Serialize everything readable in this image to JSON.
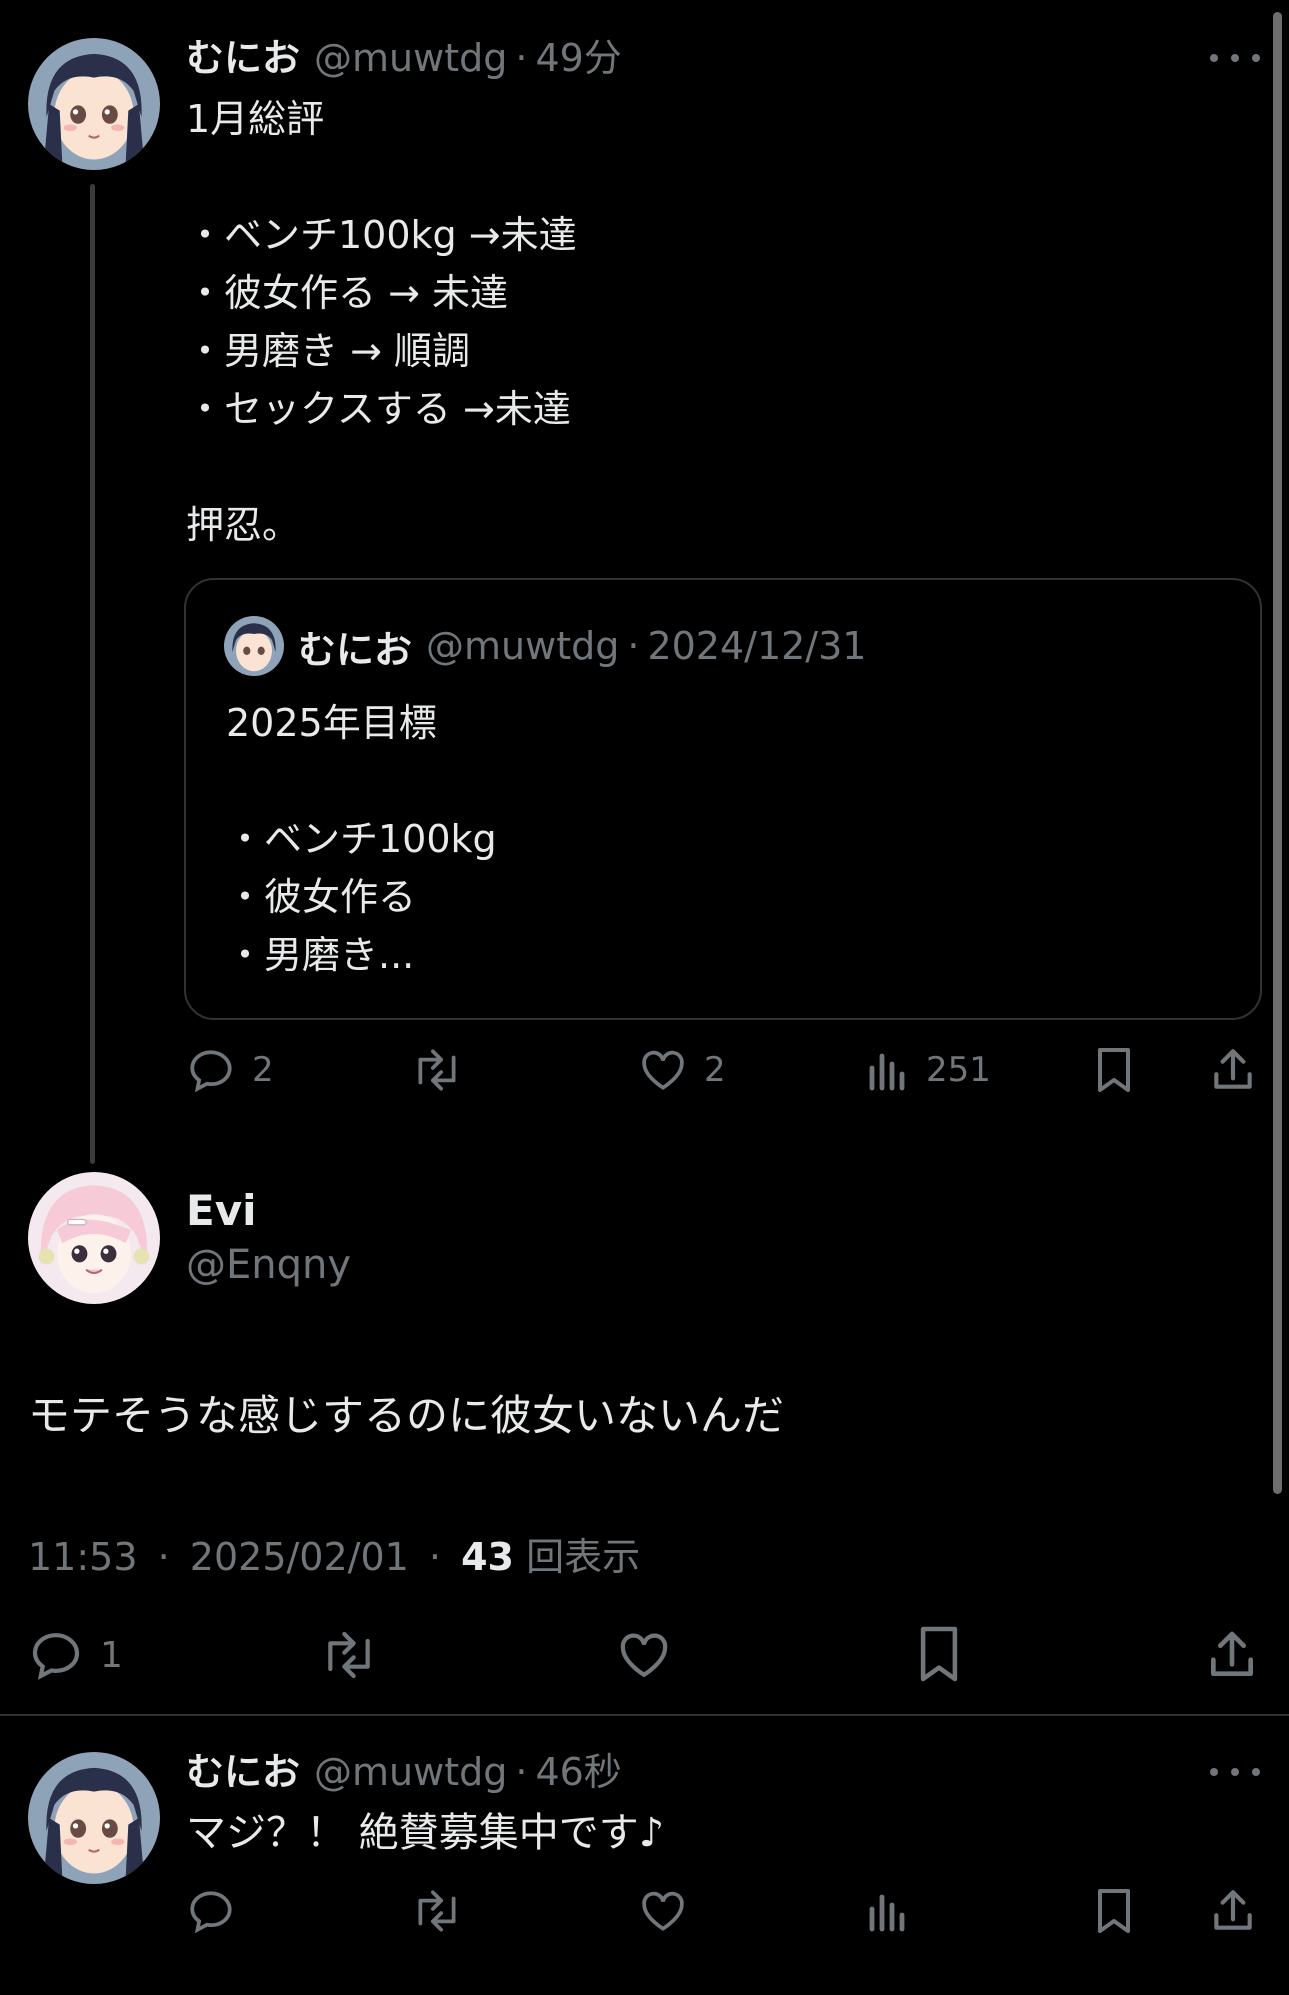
{
  "colors": {
    "background": "#000000",
    "text": "#e7e9ea",
    "muted": "#71767b",
    "border": "#2f3336"
  },
  "post1": {
    "author_name": "むにお",
    "handle": "@muwtdg",
    "separator": "·",
    "time": "49分",
    "lines": [
      "1月総評",
      "",
      "・ベンチ100kg →未達",
      "・彼女作る → 未達",
      "・男磨き → 順調",
      "・セックスする →未達",
      "",
      "押忍。"
    ],
    "quote": {
      "author_name": "むにお",
      "handle": "@muwtdg",
      "separator": "·",
      "date": "2024/12/31",
      "lines": [
        "2025年目標",
        "",
        "・ベンチ100kg",
        "・彼女作る",
        "・男磨き..."
      ]
    },
    "actions": {
      "replies": "2",
      "likes": "2",
      "views": "251"
    }
  },
  "main_post": {
    "author_name": "Evi",
    "handle": "@Enqny",
    "text": "モテそうな感じするのに彼女いないんだ",
    "time": "11:53",
    "separator": "·",
    "date": "2025/02/01",
    "views_count": "43",
    "views_label": "回表示",
    "actions": {
      "replies": "1"
    }
  },
  "post3": {
    "author_name": "むにお",
    "handle": "@muwtdg",
    "separator": "·",
    "time": "46秒",
    "text": "マジ？！ 絶賛募集中です♪"
  },
  "icons": [
    "reply-icon",
    "retweet-icon",
    "like-icon",
    "views-icon",
    "bookmark-icon",
    "share-icon",
    "more-icon"
  ]
}
